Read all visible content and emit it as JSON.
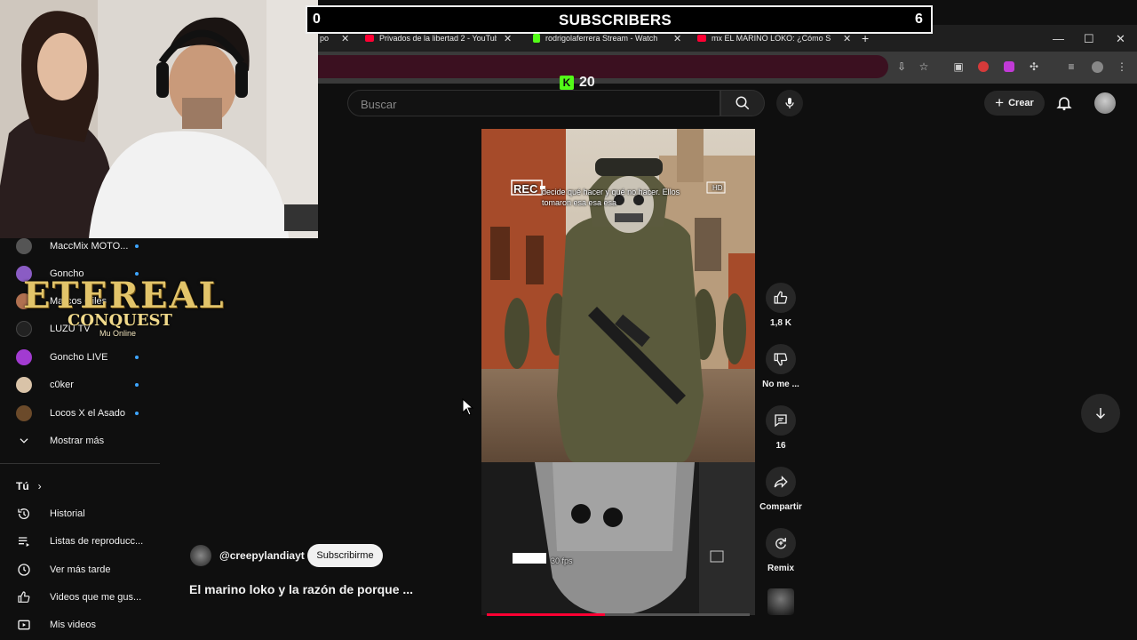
{
  "stream_overlay": {
    "subs_left": "0",
    "subs_title": "SUBSCRIBERS",
    "subs_right": "6",
    "kick_count": "20",
    "logo_line1": "ETEREAL",
    "logo_line2": "CONQUEST",
    "logo_line3": "Mu Online"
  },
  "browser": {
    "tabs": [
      {
        "label": "po",
        "icon": "tab-icon",
        "close": "✕"
      },
      {
        "label": "Privados de la libertad 2 - YouTube",
        "icon": "youtube-icon",
        "close": "✕"
      },
      {
        "label": "rodrigolaferrera Stream - Watch",
        "icon": "kick-icon",
        "close": "✕"
      },
      {
        "label": "mx EL MARINO LOKO: ¿Cómo S",
        "icon": "youtube-icon",
        "close": "✕"
      }
    ],
    "new_tab": "+",
    "window_controls": [
      "—",
      "☐",
      "✕"
    ]
  },
  "header": {
    "search_placeholder": "Buscar",
    "create_label": "Crear"
  },
  "sidebar": {
    "subscriptions": [
      {
        "name": "MaccMix MOTO...",
        "color": "#555555"
      },
      {
        "name": "Goncho",
        "color": "#8a5cc4"
      },
      {
        "name": "Marcos Giles",
        "color": "#b07050"
      },
      {
        "name": "LUZU TV",
        "color": "#222222"
      },
      {
        "name": "Goncho LIVE",
        "color": "#a23bd1"
      },
      {
        "name": "c0ker",
        "color": "#d9c3a8"
      },
      {
        "name": "Locos X el Asado",
        "color": "#6b4a2a"
      }
    ],
    "show_more": "Mostrar más",
    "you_label": "Tú",
    "you_items": [
      {
        "label": "Historial",
        "icon": "history-icon"
      },
      {
        "label": "Listas de reproducc...",
        "icon": "playlist-icon"
      },
      {
        "label": "Ver más tarde",
        "icon": "clock-icon"
      },
      {
        "label": "Videos que me gus...",
        "icon": "thumbs-up-icon"
      },
      {
        "label": "Mis videos",
        "icon": "video-icon"
      }
    ]
  },
  "short": {
    "caption": "decide qué hacer y qué no hacer. Ellos tomaron esa esa esa",
    "rec_label": "REC",
    "hd_label": "HD",
    "fps_label": "30 fps",
    "progress": 0.45,
    "channel": "@creepylandiayt",
    "subscribe_label": "Subscribirme",
    "title": "El marino loko y la razón de porque ..."
  },
  "actions": {
    "like_count": "1,8 K",
    "dislike_label": "No me ...",
    "comments_count": "16",
    "share_label": "Compartir",
    "remix_label": "Remix"
  }
}
